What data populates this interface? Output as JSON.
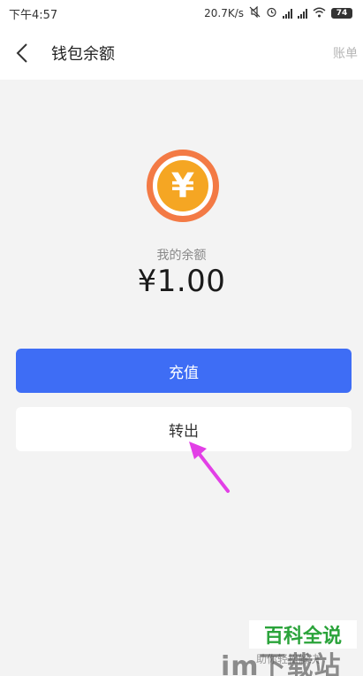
{
  "status_bar": {
    "time": "下午4:57",
    "network_speed": "20.7K/s",
    "battery": "74"
  },
  "header": {
    "back_icon": "chevron-left-icon",
    "title": "钱包余额",
    "bill_label": "账单"
  },
  "wallet": {
    "coin_symbol": "¥",
    "balance_label": "我的余额",
    "balance_amount": "¥1.00",
    "coin_ring_color": "#f37a45",
    "coin_fill_color": "#f5a623"
  },
  "actions": {
    "recharge_label": "充值",
    "transfer_label": "转出",
    "accent_color": "#3e6df5"
  },
  "annotation": {
    "arrow_color": "#e23fe6"
  },
  "watermark": {
    "brand": "百科全说",
    "sub": "助你轻松解决",
    "site": "im下载站"
  }
}
